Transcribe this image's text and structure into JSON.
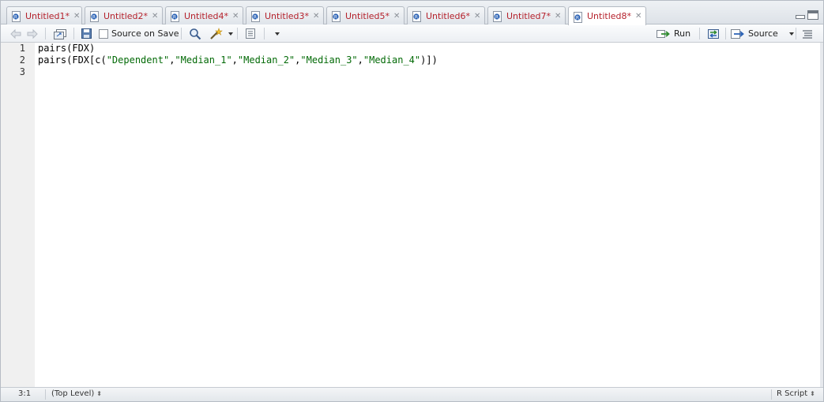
{
  "tabs": [
    {
      "label": "Untitled1*",
      "active": false
    },
    {
      "label": "Untitled2*",
      "active": false
    },
    {
      "label": "Untitled4*",
      "active": false
    },
    {
      "label": "Untitled3*",
      "active": false
    },
    {
      "label": "Untitled5*",
      "active": false
    },
    {
      "label": "Untitled6*",
      "active": false
    },
    {
      "label": "Untitled7*",
      "active": false
    },
    {
      "label": "Untitled8*",
      "active": true
    }
  ],
  "toolbar": {
    "source_on_save_label": "Source on Save",
    "run_label": "Run",
    "source_label": "Source"
  },
  "editor": {
    "line_numbers": [
      "1",
      "2",
      "3"
    ],
    "lines": [
      {
        "parts": [
          "pairs(FDX)"
        ]
      },
      {
        "parts": [
          "pairs(FDX[c(",
          "\"Dependent\"",
          ",",
          "\"Median_1\"",
          ",",
          "\"Median_2\"",
          ",",
          "\"Median_3\"",
          ",",
          "\"Median_4\"",
          ")])"
        ]
      },
      {
        "parts": [
          ""
        ]
      }
    ]
  },
  "status": {
    "cursor_position": "3:1",
    "scope": "(Top Level)",
    "file_type": "R Script"
  },
  "colors": {
    "tab_text": "#b5222c",
    "string_literal": "#036a07",
    "gutter_bg": "#f0f0f0"
  }
}
